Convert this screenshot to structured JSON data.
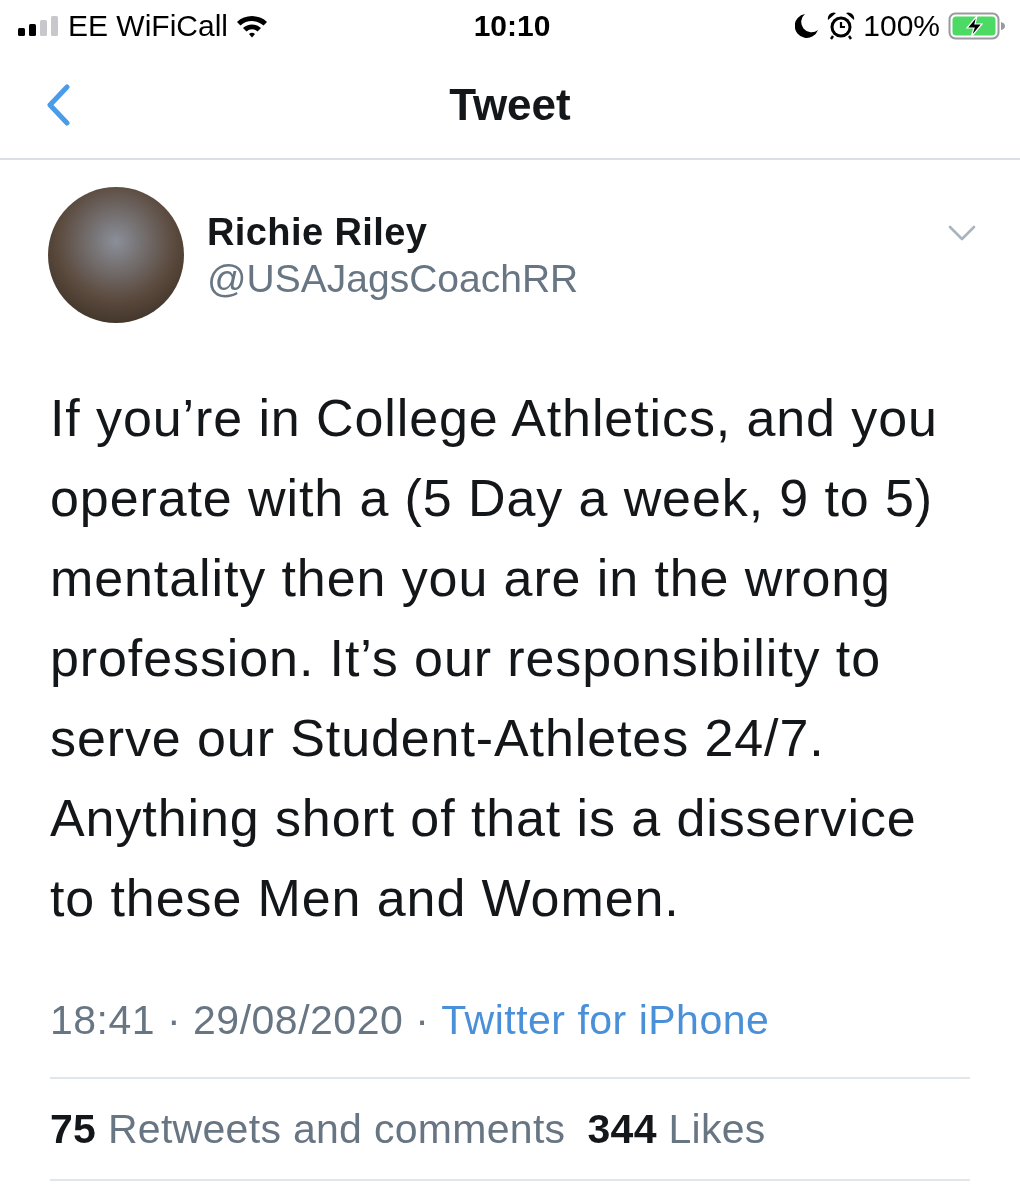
{
  "status_bar": {
    "carrier": "EE WiFiCall",
    "time": "10:10",
    "battery": "100%"
  },
  "nav": {
    "title": "Tweet"
  },
  "tweet": {
    "author": {
      "name": "Richie Riley",
      "handle": "@USAJagsCoachRR"
    },
    "text": "If you’re in College Athletics, and you operate with a (5 Day a week, 9 to 5) mentality then you are in the wrong profession. It’s our responsibility to serve our Student-Athletes 24/7. Anything short of that is a disservice to these Men and Women.",
    "meta": {
      "timestamp": "18:41 · 29/08/2020 ·",
      "source": "Twitter for iPhone"
    },
    "stats": [
      {
        "text": "**75** Retweets and comments"
      },
      {
        "text": "**344** Likes"
      }
    ]
  }
}
